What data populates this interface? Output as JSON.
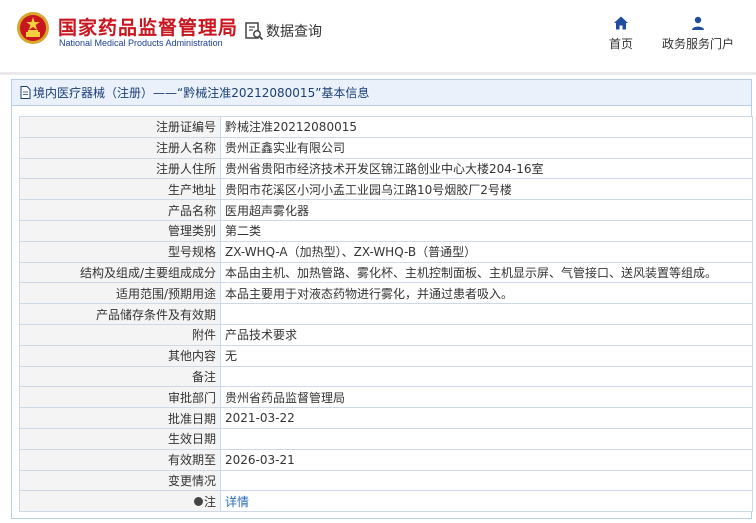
{
  "header": {
    "brand_cn": "国家药品监督管理局",
    "brand_en": "National Medical Products Administration",
    "query_label": "数据查询",
    "nav": [
      {
        "label": "首页",
        "icon": "home-icon"
      },
      {
        "label": "政务服务门户",
        "icon": "user-icon"
      }
    ]
  },
  "colors": {
    "brand_red": "#c9151e",
    "brand_blue": "#1a3f8f",
    "nav_icon": "#1f4e9e",
    "title_bar_bg": "#eaf1fa",
    "link": "#2a6bb8"
  },
  "panel": {
    "title": "境内医疗器械（注册）——“黔械注准20212080015”基本信息"
  },
  "record": {
    "rows": [
      {
        "label": "注册证编号",
        "value": "黔械注准20212080015"
      },
      {
        "label": "注册人名称",
        "value": "贵州正鑫实业有限公司"
      },
      {
        "label": "注册人住所",
        "value": "贵州省贵阳市经济技术开发区锦江路创业中心大楼204-16室"
      },
      {
        "label": "生产地址",
        "value": "贵阳市花溪区小河小孟工业园乌江路10号烟胶厂2号楼"
      },
      {
        "label": "产品名称",
        "value": "医用超声雾化器"
      },
      {
        "label": "管理类别",
        "value": "第二类"
      },
      {
        "label": "型号规格",
        "value": "ZX-WHQ-A（加热型）、ZX-WHQ-B（普通型）"
      },
      {
        "label": "结构及组成/主要组成成分",
        "value": "本品由主机、加热管路、雾化杯、主机控制面板、主机显示屏、气管接口、送风装置等组成。"
      },
      {
        "label": "适用范围/预期用途",
        "value": "本品主要用于对液态药物进行雾化，并通过患者吸入。"
      },
      {
        "label": "产品储存条件及有效期",
        "value": ""
      },
      {
        "label": "附件",
        "value": "产品技术要求"
      },
      {
        "label": "其他内容",
        "value": "无"
      },
      {
        "label": "备注",
        "value": ""
      },
      {
        "label": "审批部门",
        "value": "贵州省药品监督管理局"
      },
      {
        "label": "批准日期",
        "value": "2021-03-22"
      },
      {
        "label": "生效日期",
        "value": ""
      },
      {
        "label": "有效期至",
        "value": "2026-03-21"
      },
      {
        "label": "变更情况",
        "value": ""
      }
    ],
    "note_label": "注",
    "note_link": "详情"
  }
}
